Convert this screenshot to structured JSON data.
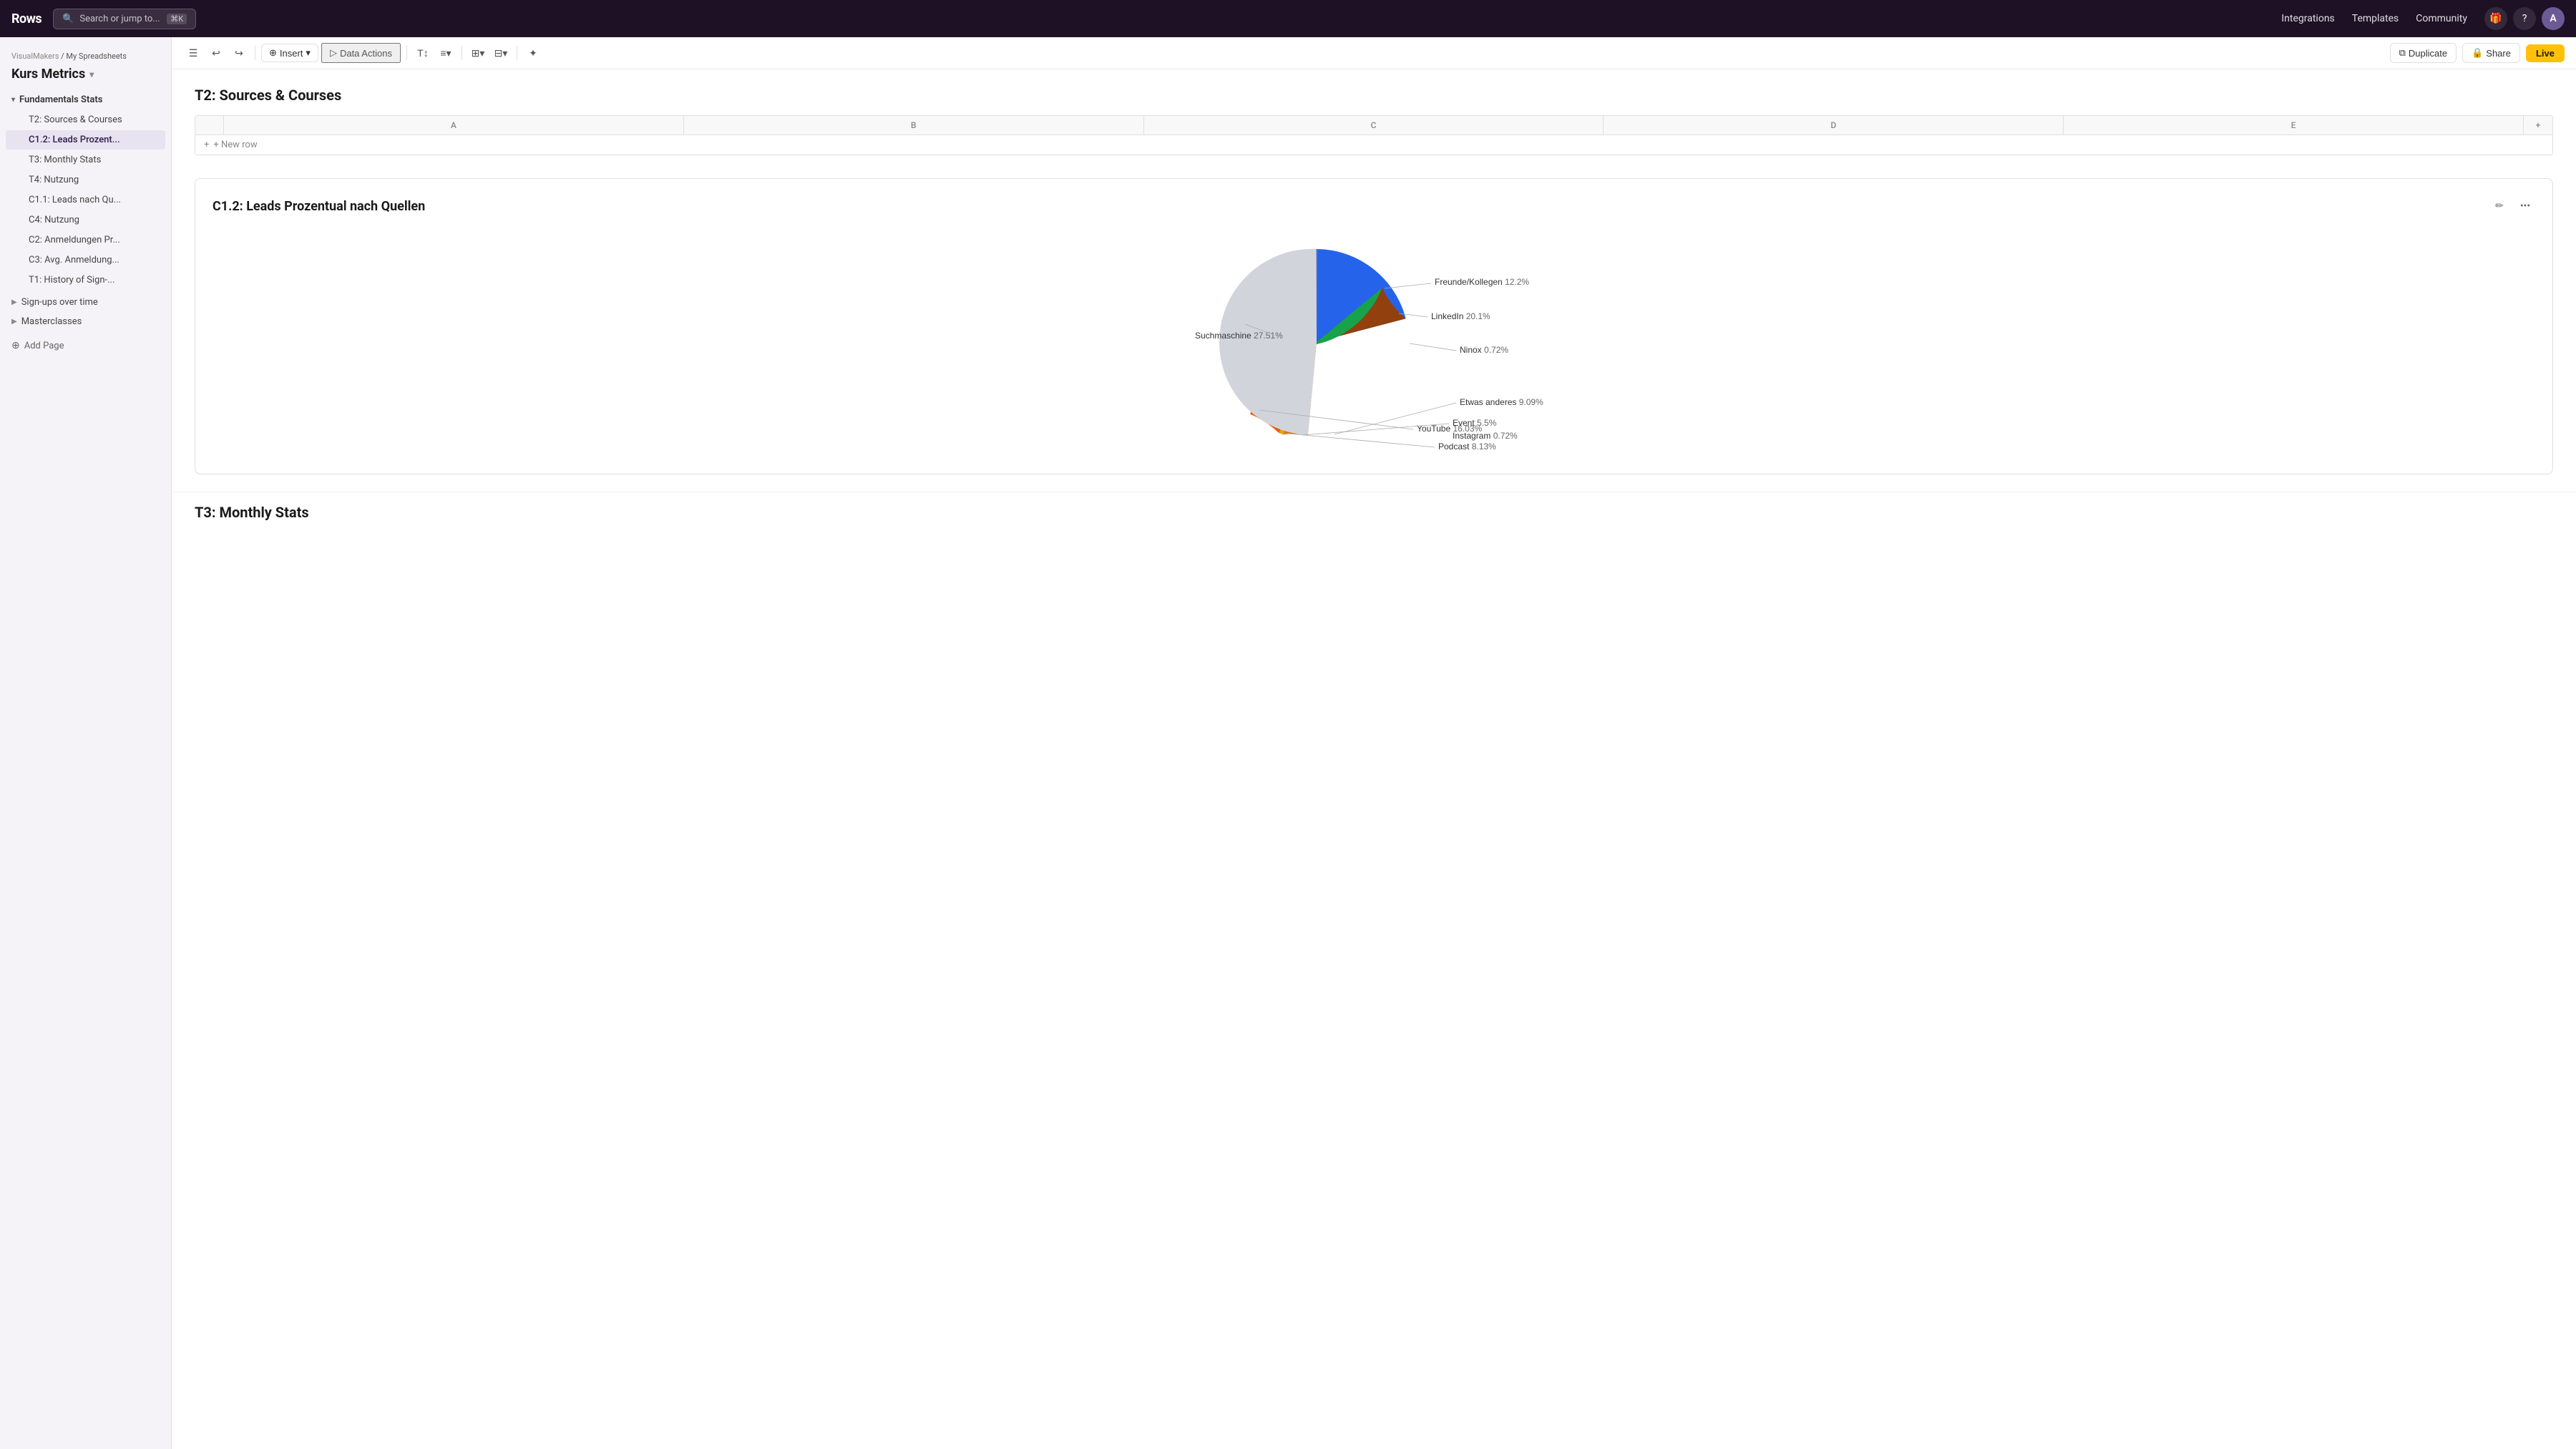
{
  "app": {
    "logo": "Rows",
    "search_placeholder": "Search or jump to...",
    "shortcut": "⌘K"
  },
  "topbar": {
    "integrations": "Integrations",
    "templates": "Templates",
    "community": "Community",
    "avatar_label": "A"
  },
  "breadcrumb": {
    "parent": "VisualMakers",
    "separator": "/",
    "current": "My Spreadsheets"
  },
  "sidebar": {
    "title": "Kurs Metrics",
    "sections": [
      {
        "label": "Fundamentals Stats",
        "expanded": true,
        "items": [
          {
            "label": "T2: Sources & Courses",
            "active": false
          },
          {
            "label": "C1.2: Leads Prozent...",
            "active": true
          },
          {
            "label": "T3: Monthly Stats",
            "active": false
          },
          {
            "label": "T4: Nutzung",
            "active": false
          },
          {
            "label": "C1.1: Leads nach Qu...",
            "active": false
          },
          {
            "label": "C4: Nutzung",
            "active": false
          },
          {
            "label": "C2: Anmeldungen Pr...",
            "active": false
          },
          {
            "label": "C3: Avg. Anmeldung...",
            "active": false
          },
          {
            "label": "T1: History of Sign-...",
            "active": false
          }
        ]
      },
      {
        "label": "Sign-ups over time",
        "expanded": false,
        "items": []
      },
      {
        "label": "Masterclasses",
        "expanded": false,
        "items": []
      }
    ],
    "add_page": "Add Page"
  },
  "toolbar": {
    "insert_label": "Insert",
    "data_actions_label": "Data Actions",
    "duplicate_label": "Duplicate",
    "share_label": "Share",
    "live_label": "Live"
  },
  "sections": [
    {
      "id": "t2",
      "title": "T2: Sources & Courses",
      "columns": [
        "A",
        "B",
        "C",
        "D",
        "E",
        "+"
      ],
      "new_row_label": "+ New row"
    }
  ],
  "chart": {
    "title": "C1.2: Leads Prozentual nach Quellen",
    "segments": [
      {
        "label": "LinkedIn",
        "pct": 20.1,
        "color": "#2563EB",
        "startAngle": -90,
        "endAngle": -17.6
      },
      {
        "label": "Freunde/Kollegen",
        "pct": 12.2,
        "color": "#92400E",
        "startAngle": -17.6,
        "endAngle": 26.3
      },
      {
        "label": "Suchmaschine",
        "pct": 27.51,
        "color": "#16A34A",
        "startAngle": 26.3,
        "endAngle": 125.1
      },
      {
        "label": "YouTube",
        "pct": 16.03,
        "color": "#DC2626",
        "startAngle": 125.1,
        "endAngle": 182.7
      },
      {
        "label": "Podcast",
        "pct": 8.13,
        "color": "#EA580C",
        "startAngle": 182.7,
        "endAngle": 212.0
      },
      {
        "label": "Instagram",
        "pct": 0.72,
        "color": "#F59E0B",
        "startAngle": 212.0,
        "endAngle": 214.6
      },
      {
        "label": "Event",
        "pct": 5.5,
        "color": "#D97706",
        "startAngle": 214.6,
        "endAngle": 234.4
      },
      {
        "label": "Etwas anderes",
        "pct": 9.09,
        "color": "#D1D5DB",
        "startAngle": 234.4,
        "endAngle": 267.1
      },
      {
        "label": "Ninox",
        "pct": 0.72,
        "color": "#9CA3AF",
        "startAngle": 267.1,
        "endAngle": 269.7
      }
    ]
  },
  "bottom_section": {
    "title": "T3: Monthly Stats"
  }
}
